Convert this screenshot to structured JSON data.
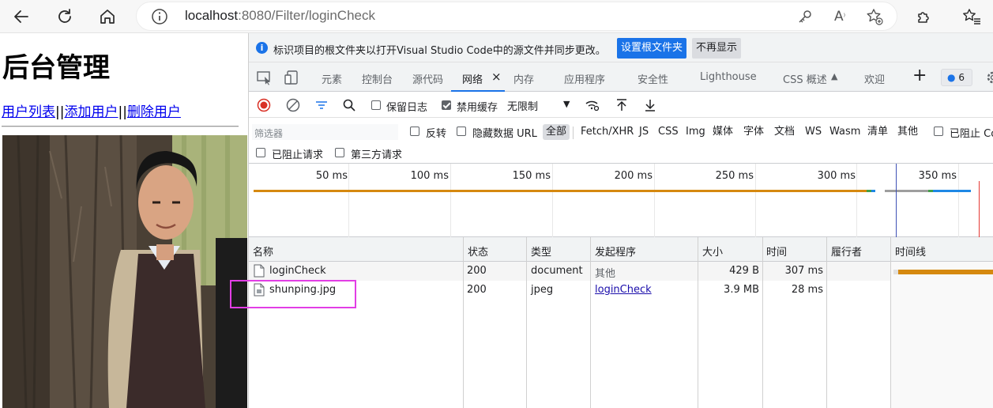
{
  "browser": {
    "url_host": "localhost",
    "url_rest": ":8080/Filter/loginCheck"
  },
  "page": {
    "title": "后台管理",
    "nav": {
      "link_list": "用户列表",
      "sep1": "||",
      "link_add": "添加用户",
      "sep2": "||",
      "link_delete": "删除用户"
    }
  },
  "devtools": {
    "infobar": {
      "text": "标识项目的根文件夹以打开Visual Studio Code中的源文件并同步更改。",
      "primary_button": "设置根文件夹",
      "secondary_button": "不再显示"
    },
    "tabs": [
      "元素",
      "控制台",
      "源代码",
      "网络",
      "内存",
      "应用程序",
      "安全性",
      "Lighthouse",
      "CSS 概述",
      "欢迎"
    ],
    "active_tab": "网络",
    "issues_count": "6",
    "controls": {
      "preserve_log": "保留日志",
      "preserve_log_checked": false,
      "disable_cache": "禁用缓存",
      "disable_cache_checked": true,
      "throttling": "无限制"
    },
    "filter": {
      "placeholder": "筛选器",
      "invert": "反转",
      "hide_data_urls": "隐藏数据 URL",
      "types": [
        "全部",
        "Fetch/XHR",
        "JS",
        "CSS",
        "Img",
        "媒体",
        "字体",
        "文档",
        "WS",
        "Wasm",
        "清单",
        "其他"
      ],
      "active_type": "全部",
      "blocked_cookies": "已阻止 Co",
      "blocked_requests": "已阻止请求",
      "third_party": "第三方请求"
    },
    "overview": {
      "ticks": [
        "50 ms",
        "100 ms",
        "150 ms",
        "200 ms",
        "250 ms",
        "300 ms",
        "350 ms"
      ],
      "colors": {
        "main": "#d68910",
        "blue": "#1e88e5",
        "green": "#43a047",
        "gray": "#9e9e9e",
        "dom": "#3f51b5",
        "load": "#e53935"
      }
    },
    "table": {
      "headers": {
        "name": "名称",
        "status": "状态",
        "type": "类型",
        "initiator": "发起程序",
        "size": "大小",
        "time": "时间",
        "fulfilled_by": "履行者",
        "waterfall": "时间线"
      },
      "rows": [
        {
          "name": "loginCheck",
          "status": "200",
          "type": "document",
          "initiator": "其他",
          "size": "429 B",
          "time": "307 ms"
        },
        {
          "name": "shunping.jpg",
          "status": "200",
          "type": "jpeg",
          "initiator": "loginCheck",
          "size": "3.9 MB",
          "time": "28 ms"
        }
      ]
    }
  }
}
